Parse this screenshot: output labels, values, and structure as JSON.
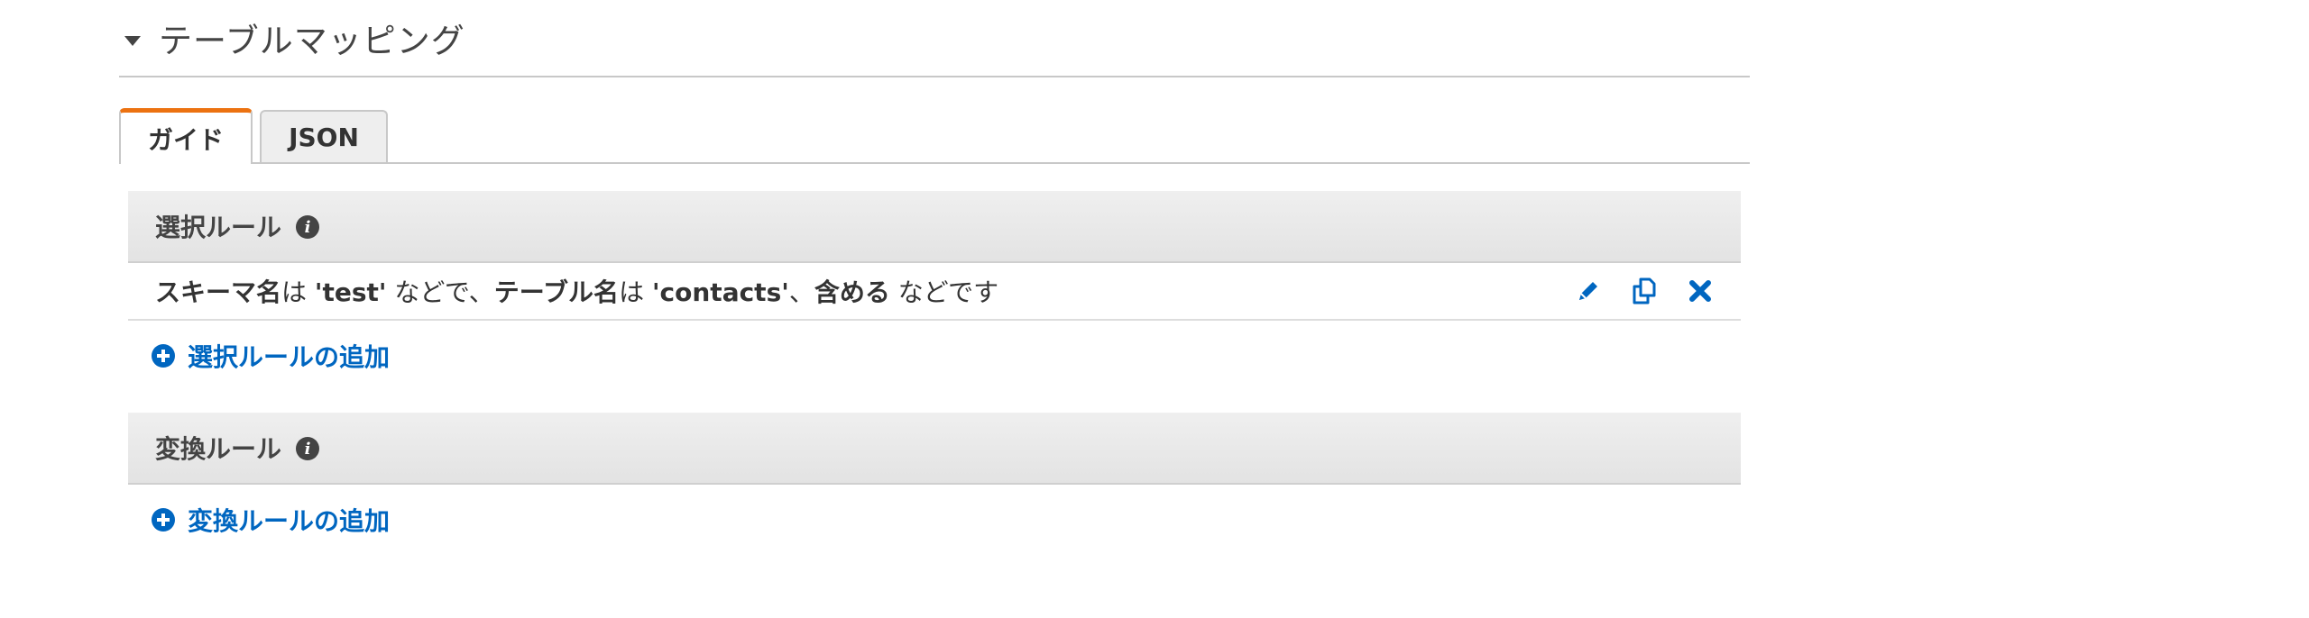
{
  "section": {
    "title": "テーブルマッピング"
  },
  "tabs": [
    {
      "label": "ガイド",
      "active": true
    },
    {
      "label": "JSON",
      "active": false
    }
  ],
  "selection_rules": {
    "header": "選択ルール",
    "rule": {
      "part1": "スキーマ名",
      "part2": "は ",
      "part3": "'test'",
      "part4": " などで、",
      "part5": "テーブル名",
      "part6": "は ",
      "part7": "'contacts'",
      "part8": "、",
      "part9": "含める",
      "part10": " などです"
    },
    "actions": [
      "edit-icon",
      "copy-icon",
      "delete-icon"
    ],
    "add_label": "選択ルールの追加"
  },
  "transformation_rules": {
    "header": "変換ルール",
    "add_label": "変換ルールの追加"
  },
  "colors": {
    "accent_tab": "#ec7211",
    "link": "#0066c0"
  }
}
